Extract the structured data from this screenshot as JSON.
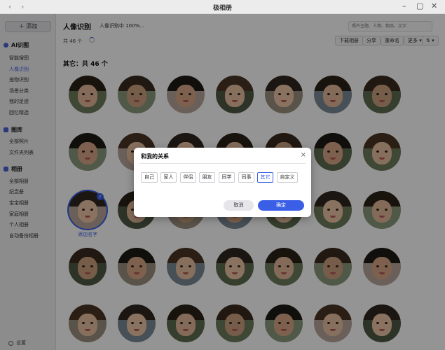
{
  "app": {
    "title": "极相册",
    "back_icon": "chevron-left-icon",
    "forward_icon": "chevron-right-icon",
    "minimize_label": "–",
    "maximize_label": "▢",
    "close_label": "✕"
  },
  "sidebar": {
    "add_label": "＋ 添加",
    "sections": [
      {
        "title": "AI识图",
        "icon": "ai-search-icon",
        "items": [
          "智能搜图",
          "人像识别",
          "宠物识别",
          "场景分类",
          "我的足迹",
          "回忆精选"
        ]
      },
      {
        "title": "图库",
        "icon": "gallery-icon",
        "items": [
          "全部照片",
          "文件夹列表"
        ]
      },
      {
        "title": "相册",
        "icon": "album-icon",
        "items": [
          "全部相册",
          "纪念册",
          "宝宝相册",
          "家庭相册",
          "个人相册",
          "自动备份相册"
        ]
      }
    ],
    "active_item": "人像识别",
    "settings_label": "设置"
  },
  "main": {
    "title": "人像识别",
    "progress_text": "人像识别中 100%...",
    "search_placeholder": "照片主题、人物、物品、文字",
    "count_text": "共 46 个",
    "toolbar": {
      "download": "下载相册",
      "share": "分享",
      "rename": "重命名",
      "more": "更多 ▾",
      "sort": "⇅ ▾"
    },
    "section_heading": "其它：共 46 个",
    "add_name_label": "添加名字",
    "check_mark": "✓"
  },
  "dialog": {
    "title": "和我的关系",
    "close_label": "×",
    "options": [
      "自己",
      "家人",
      "伴侣",
      "朋友",
      "同学",
      "同事",
      "其它",
      "自定义"
    ],
    "selected": "其它",
    "cancel_label": "取消",
    "confirm_label": "确定"
  },
  "colors": {
    "accent": "#3a5fe6",
    "overlay": "rgba(0,0,0,0.42)",
    "sidebar_bg": "#f1f1f3"
  }
}
